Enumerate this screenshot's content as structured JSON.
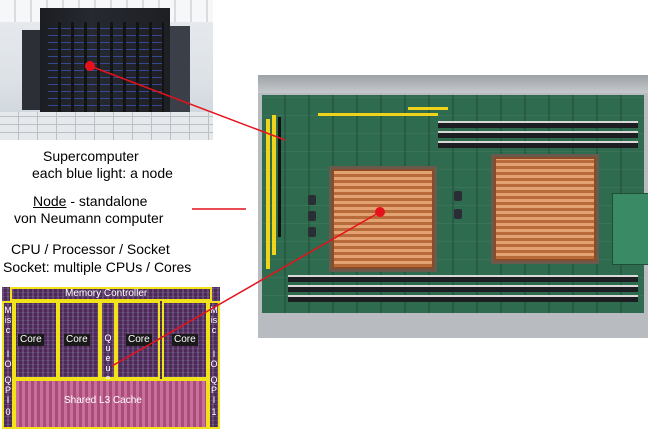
{
  "captions": {
    "supercomputer_line1": "Supercomputer",
    "supercomputer_line2": "each blue light: a node",
    "node_term": "Node",
    "node_rest": " - standalone",
    "node_line2": "von Neumann computer",
    "cpu_line1": "CPU / Processor / Socket",
    "cpu_line2": "Socket: multiple CPUs / Cores"
  },
  "die": {
    "memory_controller": "Memory Controller",
    "cores": [
      "Core",
      "Core",
      "Core",
      "Core"
    ],
    "queue": "Queue",
    "shared_cache": "Shared L3 Cache",
    "left_misc": "Misc",
    "left_io": "IO",
    "left_qpi": "QPI",
    "left_num": "0",
    "right_misc": "Misc",
    "right_io": "IO",
    "right_qpi": "QPI",
    "right_num": "1"
  },
  "colors": {
    "annotation": "#e5121b",
    "die_outline": "#f2e21a"
  }
}
